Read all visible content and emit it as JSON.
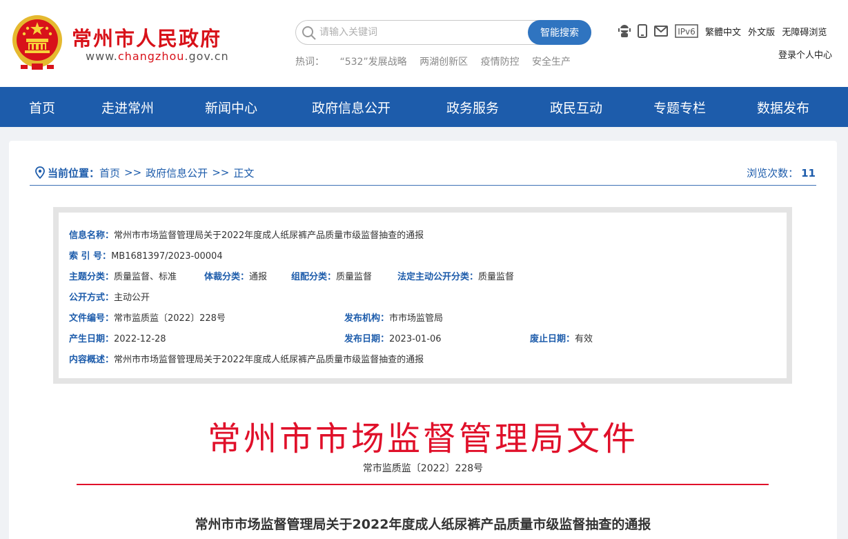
{
  "header": {
    "site_title": "常州市人民政府",
    "url_prefix": "www.",
    "url_highlight": "changzhou",
    "url_suffix": ".gov.cn",
    "search": {
      "placeholder": "请输入关键词",
      "button": "智能搜索"
    },
    "hotwords_label": "热词：",
    "hotwords": [
      "“532”发展战略",
      "两湖创新区",
      "疫情防控",
      "安全生产"
    ],
    "tool_icons": [
      "robot-icon",
      "mobile-icon",
      "mail-icon",
      "ipv6-icon"
    ],
    "ipv6_text": "IPv6",
    "links": [
      "繁體中文",
      "外文版",
      "无障碍浏览"
    ],
    "login": "登录个人中心"
  },
  "nav": [
    "首页",
    "走进常州",
    "新闻中心",
    "政府信息公开",
    "政务服务",
    "政民互动",
    "专题专栏",
    "数据发布"
  ],
  "breadcrumb": {
    "label": "当前位置：",
    "items": [
      "首页",
      "政府信息公开",
      "正文"
    ],
    "separator": ">>",
    "views_label": "浏览次数：",
    "views": "11"
  },
  "info": {
    "name_label": "信息名称：",
    "name": "常州市市场监督管理局关于2022年度成人纸尿裤产品质量市级监督抽查的通报",
    "index_label": "索 引 号：",
    "index": "MB1681397/2023-00004",
    "topic_label": "主题分类：",
    "topic": "质量监督、标准",
    "genre_label": "体裁分类：",
    "genre": "通报",
    "group_label": "组配分类：",
    "group": "质量监督",
    "legal_label": "法定主动公开分类：",
    "legal": "质量监督",
    "method_label": "公开方式：",
    "method": "主动公开",
    "docno_label": "文件编号：",
    "docno": "常市监质监〔2022〕228号",
    "issuer_label": "发布机构：",
    "issuer": "市市场监管局",
    "created_label": "产生日期：",
    "created": "2022-12-28",
    "published_label": "发布日期：",
    "published": "2023-01-06",
    "expiry_label": "废止日期：",
    "expiry": "有效",
    "summary_label": "内容概述：",
    "summary": "常州市市场监督管理局关于2022年度成人纸尿裤产品质量市级监督抽查的通报"
  },
  "document": {
    "title": "常州市市场监督管理局文件",
    "number": "常市监质监〔2022〕228号",
    "article_title": "常州市市场监督管理局关于2022年度成人纸尿裤产品质量市级监督抽查的通报"
  },
  "colors": {
    "brand_red": "#d8121a",
    "nav_blue": "#1d5cab",
    "doc_red": "#e0102a"
  }
}
